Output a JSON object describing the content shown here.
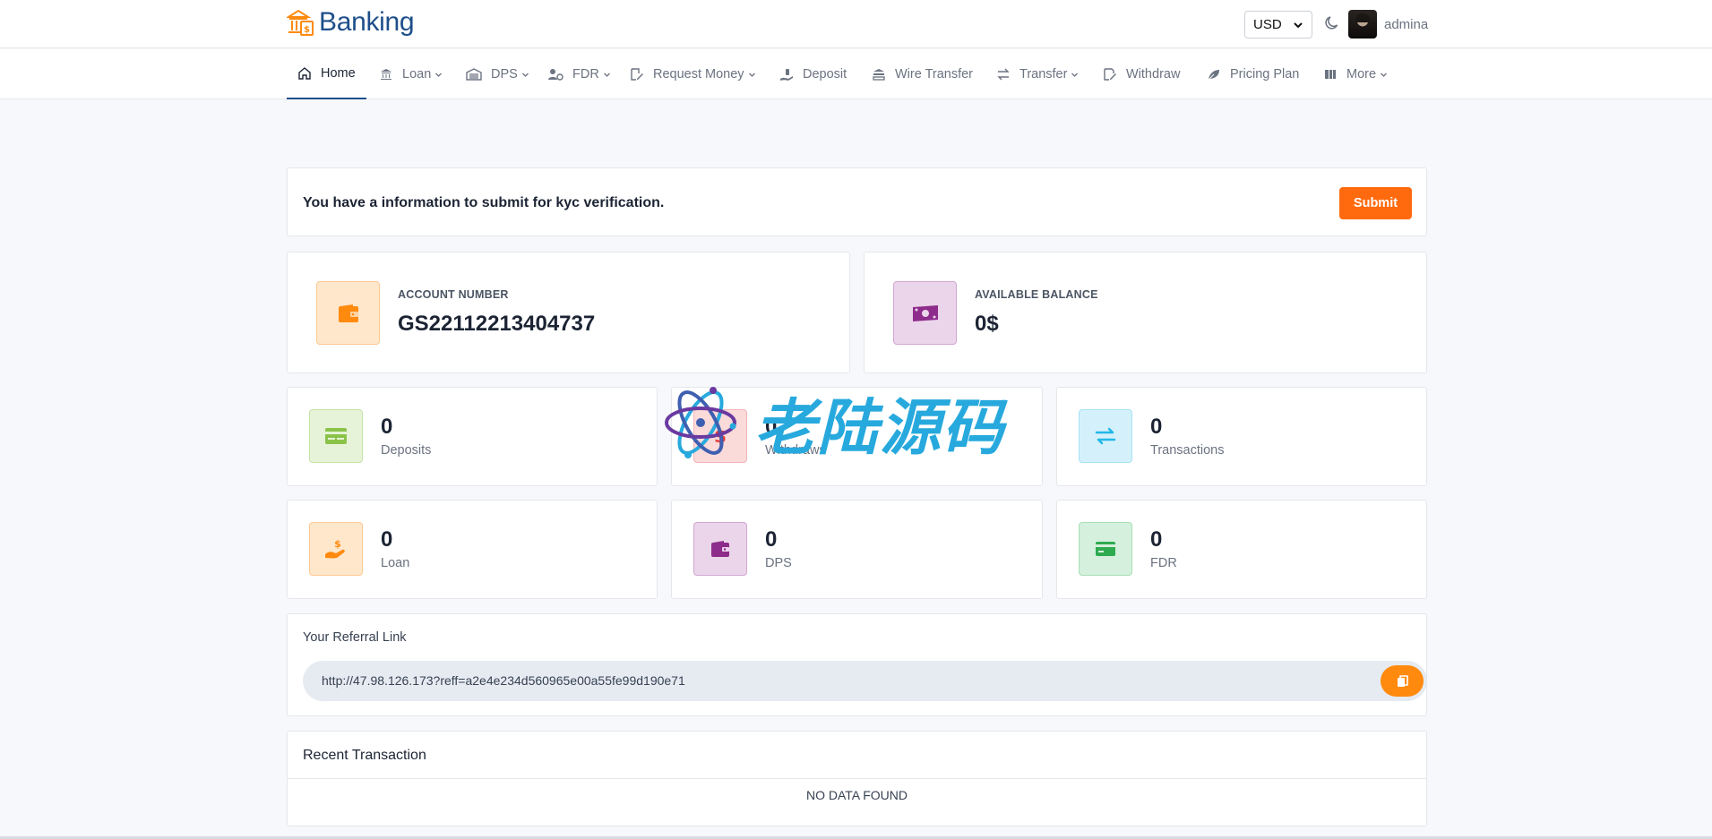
{
  "header": {
    "brand": "Banking",
    "currency": "USD",
    "username": "admina"
  },
  "nav": {
    "items": [
      {
        "label": "Home",
        "icon": "home-icon",
        "dropdown": false,
        "active": true
      },
      {
        "label": "Loan",
        "icon": "bank-icon",
        "dropdown": true
      },
      {
        "label": "DPS",
        "icon": "garage-icon",
        "dropdown": true
      },
      {
        "label": "FDR",
        "icon": "user-coin-icon",
        "dropdown": true
      },
      {
        "label": "Request Money",
        "icon": "edit-document-icon",
        "dropdown": true
      },
      {
        "label": "Deposit",
        "icon": "hand-deposit-icon",
        "dropdown": false
      },
      {
        "label": "Wire Transfer",
        "icon": "wire-icon",
        "dropdown": false
      },
      {
        "label": "Transfer",
        "icon": "transfer-arrows-icon",
        "dropdown": true
      },
      {
        "label": "Withdraw",
        "icon": "withdraw-document-icon",
        "dropdown": false
      },
      {
        "label": "Pricing Plan",
        "icon": "leaf-icon",
        "dropdown": false
      },
      {
        "label": "More",
        "icon": "grid-icon",
        "dropdown": true
      }
    ]
  },
  "kyc": {
    "message": "You have a information to submit for kyc verification.",
    "submit_label": "Submit"
  },
  "account": {
    "number_label": "ACCOUNT NUMBER",
    "number": "GS22112213404737",
    "balance_label": "AVAILABLE BALANCE",
    "balance": "0$"
  },
  "stats": [
    {
      "value": "0",
      "label": "Deposits",
      "icon": "credit-card-icon",
      "color": "#8bc34a",
      "bg": "#e6f3d8"
    },
    {
      "value": "0",
      "label": "Withdraws",
      "icon": "money-icon",
      "color": "#e53935",
      "bg": "#fbdada"
    },
    {
      "value": "0",
      "label": "Transactions",
      "icon": "exchange-icon",
      "color": "#22b8e8",
      "bg": "#d4f1fb"
    },
    {
      "value": "0",
      "label": "Loan",
      "icon": "hand-coin-icon",
      "color": "#ff8a0e",
      "bg": "#ffe7cc"
    },
    {
      "value": "0",
      "label": "DPS",
      "icon": "wallet-icon",
      "color": "#8e2c8c",
      "bg": "#ebd5ea"
    },
    {
      "value": "0",
      "label": "FDR",
      "icon": "card-icon",
      "color": "#2eaa4f",
      "bg": "#d5f0dc"
    }
  ],
  "referral": {
    "title": "Your Referral Link",
    "url": "http://47.98.126.173?reff=a2e4e234d560965e00a55fe99d190e71"
  },
  "transactions": {
    "title": "Recent Transaction",
    "empty": "NO DATA FOUND"
  },
  "watermark": {
    "text": "老陆源码"
  }
}
